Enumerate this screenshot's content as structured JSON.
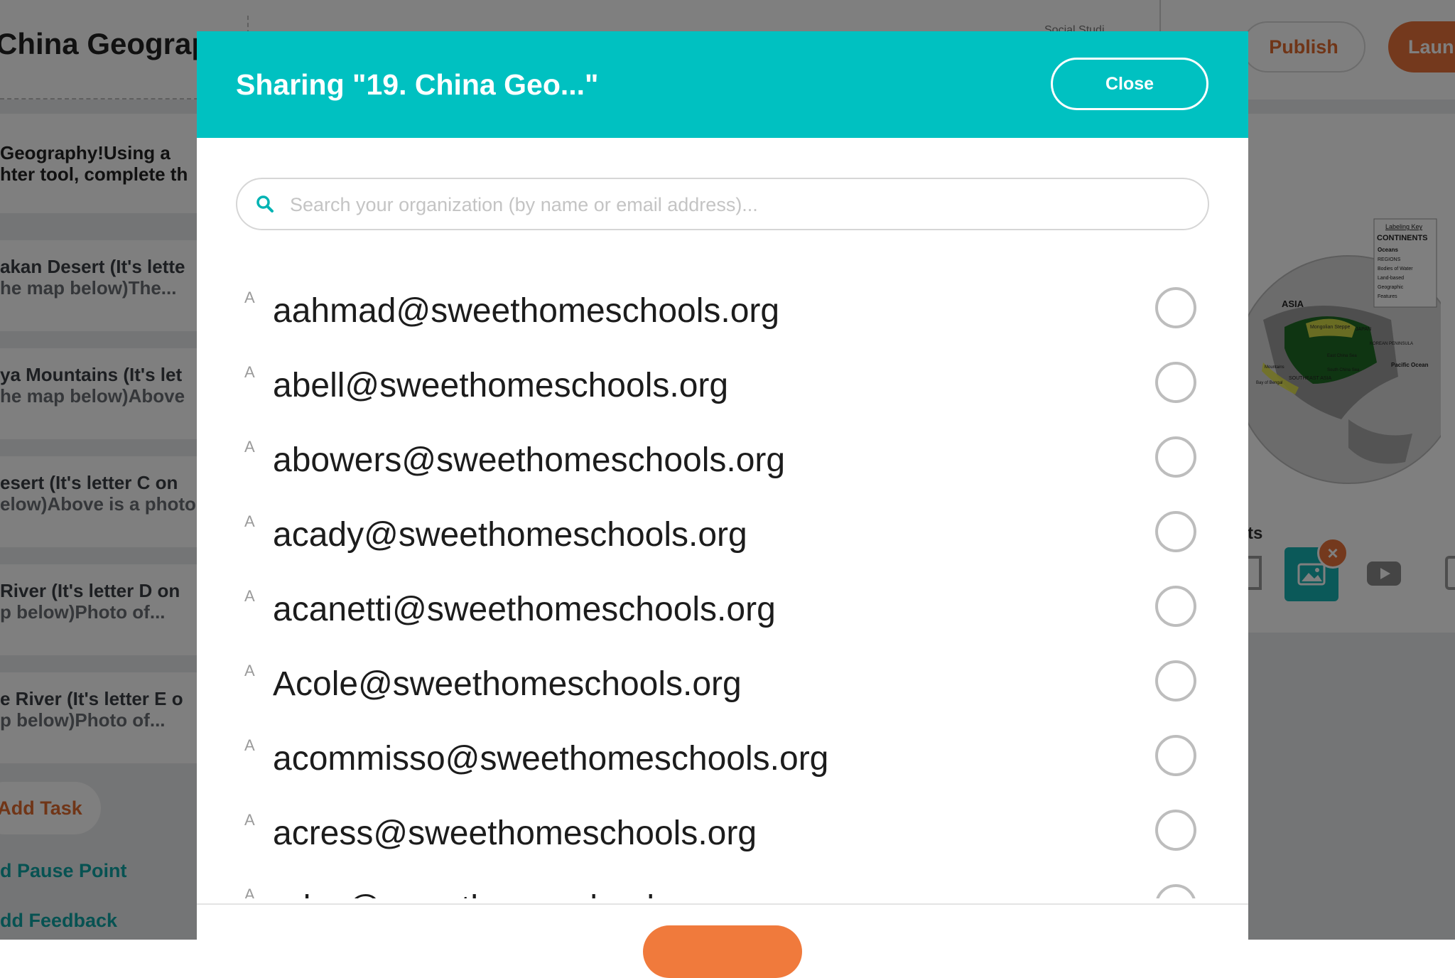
{
  "background": {
    "title": "China Geograp",
    "faint_label": "Social Studi...",
    "publish_label": "Publish",
    "launch_label": "Laun",
    "intro_lines": [
      "Geography!Using a",
      "hter tool, complete th"
    ],
    "tasks": [
      {
        "line1": "akan Desert (It's lette",
        "line2": "he map below)The..."
      },
      {
        "line1": "ya Mountains (It's let",
        "line2": "he map below)Above"
      },
      {
        "line1": "esert (It's letter C on",
        "line2": "elow)Above is a photo"
      },
      {
        "line1": " River (It's letter D on",
        "line2": "p below)Photo of..."
      },
      {
        "line1": "e River (It's letter E o",
        "line2": "p below)Photo of..."
      }
    ],
    "add_task_label": "Add Task",
    "pause_point_label": "d Pause Point",
    "feedback_label": "dd Feedback",
    "attachments_label": "ts",
    "map_labels": {
      "key_title": "Labeling Key",
      "key_heading": "CONTINENTS",
      "key_items": [
        "Oceans",
        "REGIONS",
        "Bodies of Water",
        "Land-based",
        "Geographic",
        "Features"
      ],
      "asia": "ASIA",
      "mongolian_steppe": "Mongolian Steppe",
      "japan": "JAPAN",
      "korean_peninsula": "KOREAN PENINSULA",
      "pacific_ocean": "Pacific Ocean",
      "southeast_asia": "SOUTHEAST ASIA",
      "bay_of_bengal": "Bay of Bengal",
      "east_china_sea": "East China Sea",
      "south_china_sea": "South China Sea",
      "mountains": "Mountains"
    }
  },
  "modal": {
    "title": "Sharing \"19. China Geo...\"",
    "close_label": "Close",
    "search_placeholder": "Search your organization (by name or email address)...",
    "avatar_letter": "A",
    "users": [
      "aahmad@sweethomeschools.org",
      "abell@sweethomeschools.org",
      "abowers@sweethomeschools.org",
      "acady@sweethomeschools.org",
      "acanetti@sweethomeschools.org",
      "Acole@sweethomeschools.org",
      "acommisso@sweethomeschools.org",
      "acress@sweethomeschools.org",
      "adec@sweethomeschools.org"
    ]
  },
  "colors": {
    "accent_teal": "#00c1c1",
    "accent_orange": "#f07a3c"
  }
}
